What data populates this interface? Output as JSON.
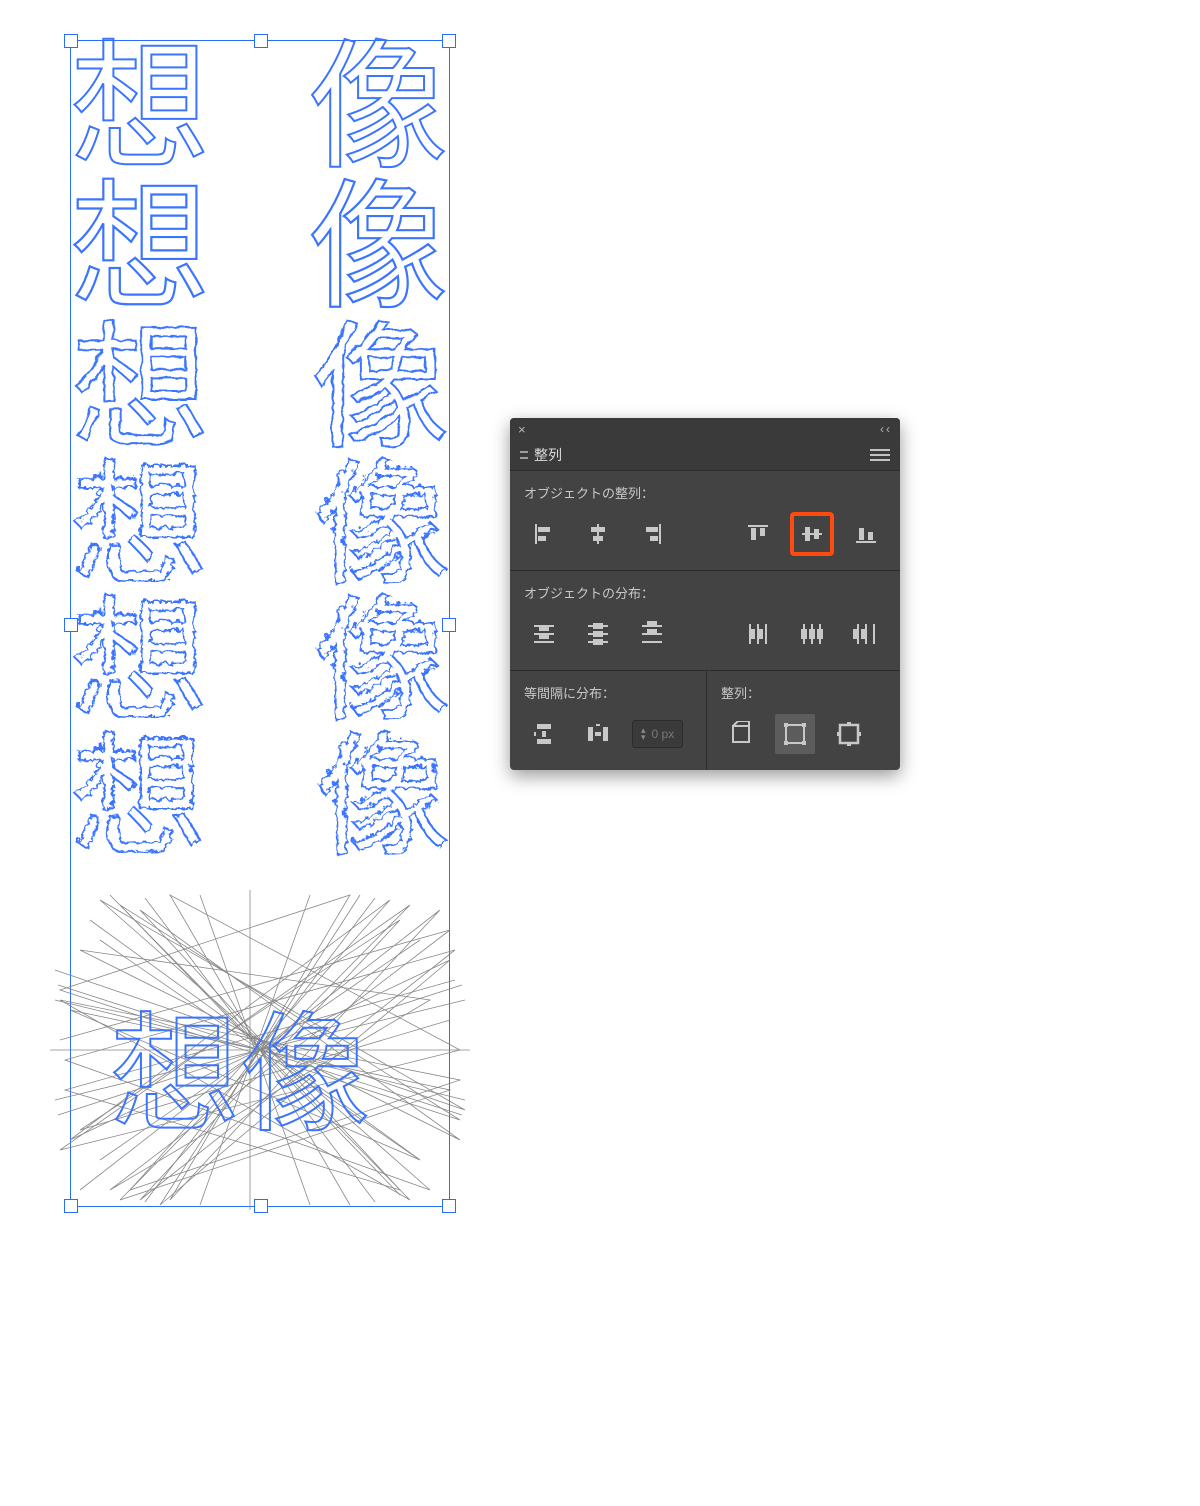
{
  "canvas": {
    "col_left_char": "想",
    "col_right_char": "像",
    "final_text": "想像"
  },
  "panel": {
    "title": "整列",
    "sections": {
      "align_label": "オブジェクトの整列：",
      "distribute_label": "オブジェクトの分布：",
      "spacing_label": "等間隔に分布：",
      "align_to_label": "整列："
    },
    "spacing_value": "0 px",
    "align_buttons": {
      "h_left": "horizontal-align-left",
      "h_center": "horizontal-align-center",
      "h_right": "horizontal-align-right",
      "v_top": "vertical-align-top",
      "v_middle": "vertical-align-middle",
      "v_bottom": "vertical-align-bottom"
    },
    "dist_buttons": {
      "v_top": "distribute-vertical-top",
      "v_center": "distribute-vertical-center",
      "v_bottom": "distribute-vertical-bottom",
      "h_left": "distribute-horizontal-left",
      "h_center": "distribute-horizontal-center",
      "h_right": "distribute-horizontal-right"
    },
    "align_to_options": {
      "artboard": "align-to-artboard",
      "selection": "align-to-selection",
      "key": "align-to-key-object"
    }
  }
}
